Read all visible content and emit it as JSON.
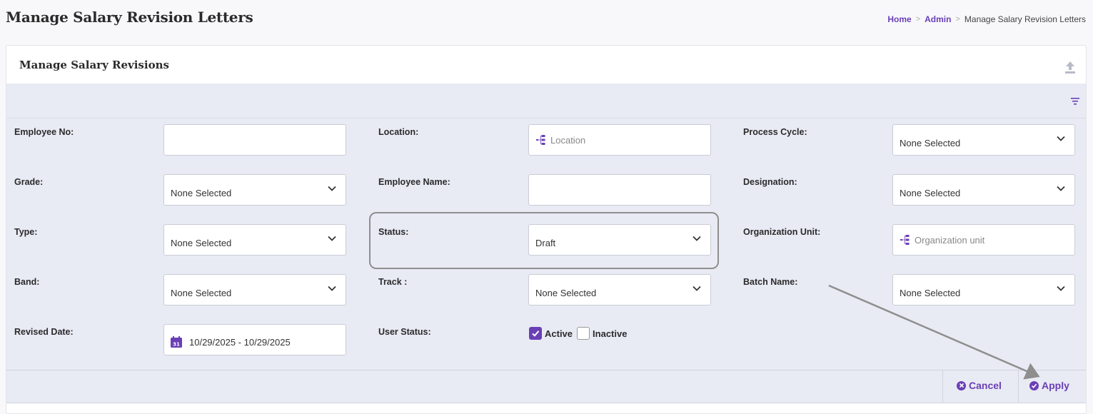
{
  "page": {
    "title": "Manage Salary Revision Letters"
  },
  "breadcrumb": {
    "items": [
      "Home",
      "Admin",
      "Manage Salary Revision Letters"
    ],
    "separator": ">"
  },
  "card": {
    "title": "Manage Salary Revisions"
  },
  "filters": {
    "employee_no": {
      "label": "Employee No:",
      "value": ""
    },
    "location": {
      "label": "Location:",
      "placeholder": "Location"
    },
    "process_cycle": {
      "label": "Process Cycle:",
      "value": "None Selected"
    },
    "grade": {
      "label": "Grade:",
      "value": "None Selected"
    },
    "employee_name": {
      "label": "Employee Name:",
      "value": ""
    },
    "designation": {
      "label": "Designation:",
      "value": "None Selected"
    },
    "type": {
      "label": "Type:",
      "value": "None Selected"
    },
    "status": {
      "label": "Status:",
      "value": "Draft"
    },
    "organization_unit": {
      "label": "Organization Unit:",
      "placeholder": "Organization unit"
    },
    "band": {
      "label": "Band:",
      "value": "None Selected"
    },
    "track": {
      "label": "Track :",
      "value": "None Selected"
    },
    "batch_name": {
      "label": "Batch Name:",
      "value": "None Selected"
    },
    "revised_date": {
      "label": "Revised Date:",
      "value": "10/29/2025 - 10/29/2025",
      "calendar_day": "31"
    },
    "user_status": {
      "label": "User Status:",
      "options": [
        {
          "label": "Active",
          "checked": true
        },
        {
          "label": "Inactive",
          "checked": false
        }
      ]
    }
  },
  "actions": {
    "cancel": "Cancel",
    "apply": "Apply"
  },
  "colors": {
    "accent": "#6a3fb5",
    "panel_bg": "#e8eaf4"
  }
}
